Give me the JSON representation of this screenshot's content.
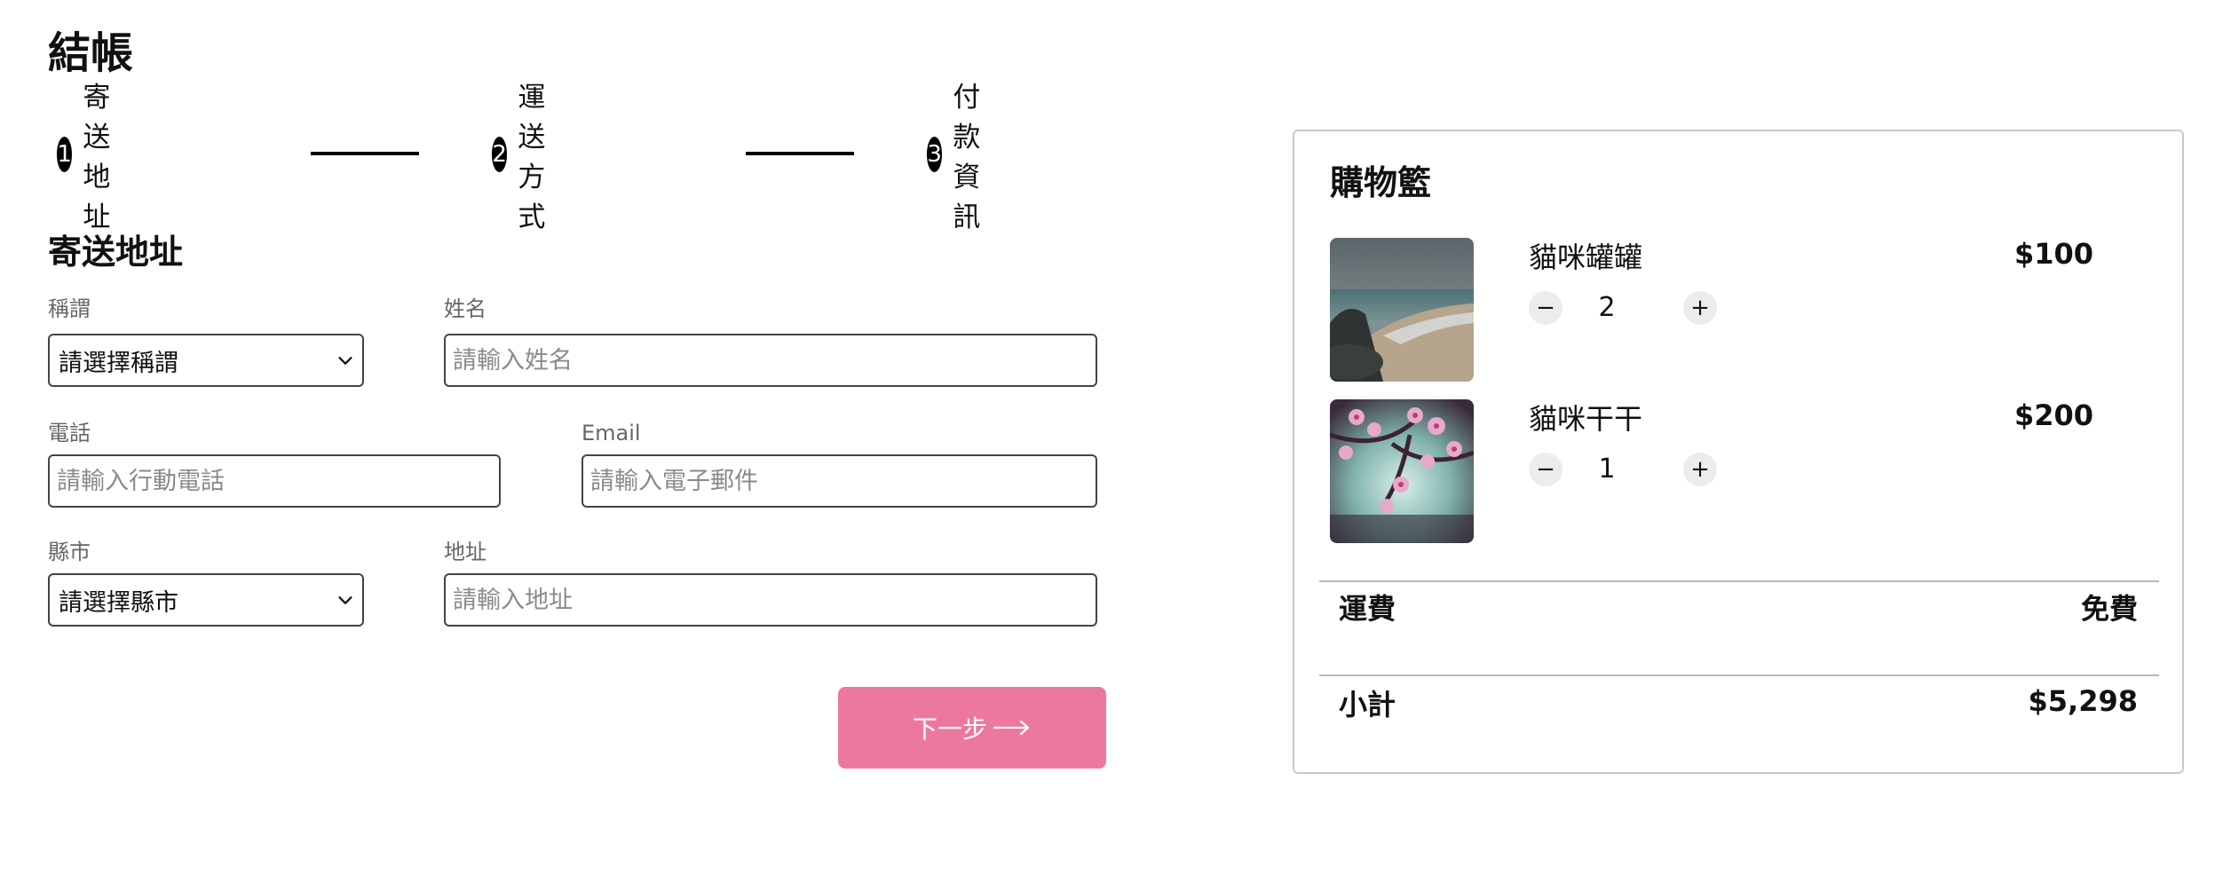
{
  "page": {
    "title": "結帳"
  },
  "steps": [
    {
      "number": "1",
      "label": "寄送地址"
    },
    {
      "number": "2",
      "label": "運送方式"
    },
    {
      "number": "3",
      "label": "付款資訊"
    }
  ],
  "form": {
    "section_title": "寄送地址",
    "title_field": {
      "label": "稱謂",
      "value": "請選擇稱謂"
    },
    "name_field": {
      "label": "姓名",
      "placeholder": "請輸入姓名"
    },
    "phone_field": {
      "label": "電話",
      "placeholder": "請輸入行動電話"
    },
    "email_field": {
      "label": "Email",
      "placeholder": "請輸入電子郵件"
    },
    "city_field": {
      "label": "縣市",
      "value": "請選擇縣市"
    },
    "address_field": {
      "label": "地址",
      "placeholder": "請輸入地址"
    },
    "next_button": {
      "label": "下一步",
      "icon": "arrow-right-icon"
    }
  },
  "cart": {
    "title": "購物籃",
    "items": [
      {
        "name": "貓咪罐罐",
        "price": "$100",
        "quantity": "2",
        "image": "beach-photo"
      },
      {
        "name": "貓咪干干",
        "price": "$200",
        "quantity": "1",
        "image": "cherry-blossom-photo"
      }
    ],
    "shipping": {
      "label": "運費",
      "value": "免費"
    },
    "subtotal": {
      "label": "小計",
      "value": "$5,298"
    }
  },
  "colors": {
    "accent": "#ed789e",
    "border": "#c9c9c9",
    "step_dot": "#000000"
  }
}
